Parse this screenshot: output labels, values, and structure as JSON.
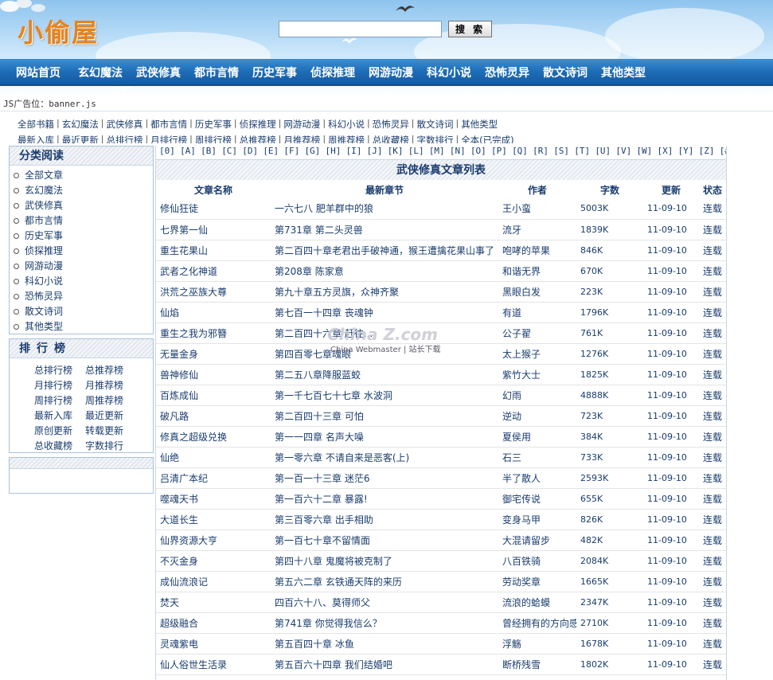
{
  "site": {
    "logo": "小偷屋"
  },
  "search": {
    "placeholder": "",
    "button_label": "搜 索"
  },
  "nav": {
    "items": [
      "网站首页",
      "玄幻魔法",
      "武侠修真",
      "都市言情",
      "历史军事",
      "侦探推理",
      "网游动漫",
      "科幻小说",
      "恐怖灵异",
      "散文诗词",
      "其他类型"
    ]
  },
  "ad_text": "JS广告位：banner.js",
  "subnav": {
    "line1": [
      "全部书籍",
      "玄幻魔法",
      "武侠修真",
      "都市言情",
      "历史军事",
      "侦探推理",
      "网游动漫",
      "科幻小说",
      "恐怖灵异",
      "散文诗词",
      "其他类型"
    ],
    "line2": [
      "最新入库",
      "最近更新",
      "总排行榜",
      "月排行榜",
      "周排行榜",
      "总推荐榜",
      "月推荐榜",
      "周推荐榜",
      "总收藏榜",
      "字数排行",
      "全本(已完成)"
    ]
  },
  "sidebar": {
    "category_title": "分类阅读",
    "categories": [
      "全部文章",
      "玄幻魔法",
      "武侠修真",
      "都市言情",
      "历史军事",
      "侦探推理",
      "网游动漫",
      "科幻小说",
      "恐怖灵异",
      "散文诗词",
      "其他类型"
    ],
    "rank_title": "排行榜",
    "ranks": [
      "总排行榜",
      "总推荐榜",
      "月排行榜",
      "月推荐榜",
      "周排行榜",
      "周推荐榜",
      "最新入库",
      "最近更新",
      "原创更新",
      "转载更新",
      "总收藏榜",
      "字数排行"
    ]
  },
  "letters": [
    "[0]",
    "[A]",
    "[B]",
    "[C]",
    "[D]",
    "[E]",
    "[F]",
    "[G]",
    "[H]",
    "[I]",
    "[J]",
    "[K]",
    "[L]",
    "[M]",
    "[N]",
    "[O]",
    "[P]",
    "[Q]",
    "[R]",
    "[S]",
    "[T]",
    "[U]",
    "[V]",
    "[W]",
    "[X]",
    "[Y]",
    "[Z]",
    "[#]"
  ],
  "list": {
    "title": "武侠修真文章列表",
    "columns": [
      "文章名称",
      "最新章节",
      "作者",
      "字数",
      "更新",
      "状态"
    ],
    "rows": [
      [
        "修仙狂徒",
        "一六七八 肥羊群中的狼",
        "王小蛮",
        "5003K",
        "11-09-10",
        "连载"
      ],
      [
        "七界第一仙",
        "第731章 第二头灵兽",
        "流牙",
        "1839K",
        "11-09-10",
        "连载"
      ],
      [
        "重生花果山",
        "第二百四十章老君出手破神通，猴王遭擒花果山事了",
        "咆哮的苹果",
        "846K",
        "11-09-10",
        "连载"
      ],
      [
        "武者之化神道",
        "第208章 陈家意",
        "和谐无界",
        "670K",
        "11-09-10",
        "连载"
      ],
      [
        "洪荒之巫族大尊",
        "第九十章五方灵旗，众神齐聚",
        "黑眼白发",
        "223K",
        "11-09-10",
        "连载"
      ],
      [
        "仙焰",
        "第七百一十四章 丧魂钟",
        "有道",
        "1796K",
        "11-09-10",
        "连载"
      ],
      [
        "重生之我为邪簪",
        "第二百四十六章 赶往...",
        "公子翟",
        "761K",
        "11-09-10",
        "连载"
      ],
      [
        "无量金身",
        "第四百零七章魂眼",
        "太上猴子",
        "1276K",
        "11-09-10",
        "连载"
      ],
      [
        "兽神修仙",
        "第二五八章降服蓝蛟",
        "紫竹大士",
        "1825K",
        "11-09-10",
        "连载"
      ],
      [
        "百炼成仙",
        "第一千七百七十七章 水波洞",
        "幻雨",
        "4888K",
        "11-09-10",
        "连载"
      ],
      [
        "破凡路",
        "第二百四十三章 可怕",
        "逆动",
        "723K",
        "11-09-10",
        "连载"
      ],
      [
        "修真之超级兑换",
        "第一一四章 名声大噪",
        "夏侯用",
        "384K",
        "11-09-10",
        "连载"
      ],
      [
        "仙绝",
        "第一零六章 不请自来是恶客(上)",
        "石三",
        "733K",
        "11-09-10",
        "连载"
      ],
      [
        "吕清广本纪",
        "第一百一十三章 迷茫6",
        "半了散人",
        "2593K",
        "11-09-10",
        "连载"
      ],
      [
        "噬魂天书",
        "第一百六十二章 暴露!",
        "御宅传说",
        "655K",
        "11-09-10",
        "连载"
      ],
      [
        "大道长生",
        "第三百零六章 出手相助",
        "变身马甲",
        "826K",
        "11-09-10",
        "连载"
      ],
      [
        "仙界资源大亨",
        "第一百七十章不留情面",
        "大混请留步",
        "482K",
        "11-09-10",
        "连载"
      ],
      [
        "不灭金身",
        "第四十八章 鬼魔将被克制了",
        "八百铁骑",
        "2084K",
        "11-09-10",
        "连载"
      ],
      [
        "成仙流浪记",
        "第五六二章 玄铁通天阵的来历",
        "劳动奖章",
        "1665K",
        "11-09-10",
        "连载"
      ],
      [
        "焚天",
        "四百六十八、莫得师父",
        "流浪的蛤蟆",
        "2347K",
        "11-09-10",
        "连载"
      ],
      [
        "超级融合",
        "第741章 你觉得我信么？",
        "曾经拥有的方向感",
        "2710K",
        "11-09-10",
        "连载"
      ],
      [
        "灵魂紫电",
        "第五百四十章 冰鱼",
        "浮觞",
        "1678K",
        "11-09-10",
        "连载"
      ],
      [
        "仙人俗世生活录",
        "第五百六十四章 我们结婚吧",
        "断桥残雪",
        "1802K",
        "11-09-10",
        "连载"
      ]
    ]
  },
  "watermark": {
    "brand": "China Z.com",
    "sub": "China Webmaster | 站长下载"
  }
}
